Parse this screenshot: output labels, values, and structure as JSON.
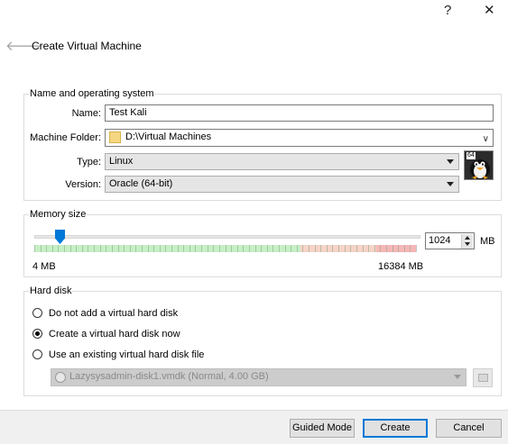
{
  "window": {
    "help_glyph": "?",
    "close_glyph": "✕",
    "back_glyph": "🡐",
    "title": "Create Virtual Machine"
  },
  "name_os": {
    "legend": "Name and operating system",
    "name_label": "Name:",
    "name_value": "Test Kali",
    "folder_label": "Machine Folder:",
    "folder_value": "D:\\Virtual Machines",
    "type_label": "Type:",
    "type_value": "Linux",
    "version_label": "Version:",
    "version_value": "Oracle (64-bit)",
    "os_badge": "64"
  },
  "memory": {
    "legend": "Memory size",
    "min_label": "4 MB",
    "max_label": "16384 MB",
    "value": "1024",
    "unit": "MB"
  },
  "hard_disk": {
    "legend": "Hard disk",
    "options": [
      {
        "label": "Do not add a virtual hard disk",
        "selected": false
      },
      {
        "label": "Create a virtual hard disk now",
        "selected": true
      },
      {
        "label": "Use an existing virtual hard disk file",
        "selected": false
      }
    ],
    "existing_file": "Lazysysadmin-disk1.vmdk (Normal, 4.00 GB)"
  },
  "footer": {
    "guided_mode": "Guided Mode",
    "create": "Create",
    "cancel": "Cancel"
  },
  "colors": {
    "accent": "#0078d7",
    "safe_zone": "#c6efc6",
    "warn_zone": "#f6d3c8",
    "danger_zone": "#f5b7b7"
  }
}
